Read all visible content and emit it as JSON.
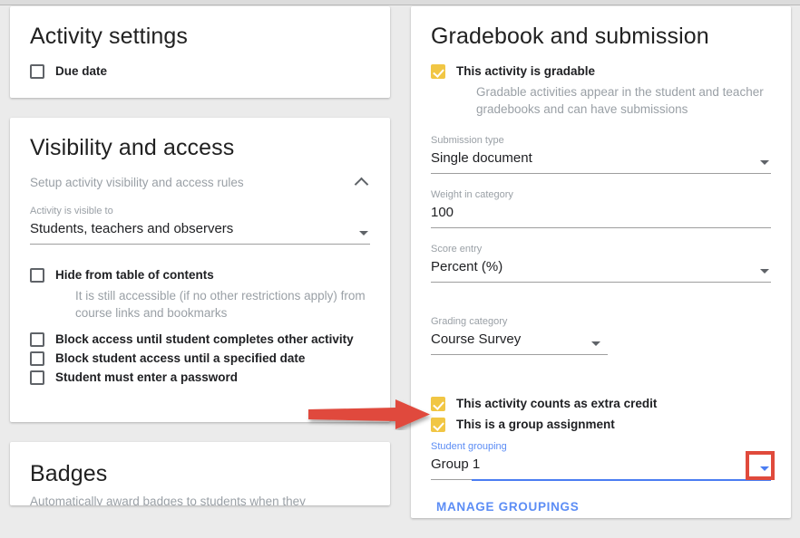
{
  "theme": {
    "accent_yellow": "#f1c644",
    "accent_blue": "#5c8df5",
    "annotation_red": "#e04a3c",
    "page_bg": "#ebebeb",
    "card_bg": "#ffffff",
    "text_primary": "#202124",
    "text_muted": "#9aa0a6"
  },
  "left_column": {
    "activity_settings": {
      "title": "Activity settings",
      "due_date": {
        "label": "Due date",
        "checked": false
      }
    },
    "visibility_and_access": {
      "title": "Visibility and access",
      "collapse_header": "Setup activity visibility and access rules",
      "collapse_icon": "chevron-up-icon",
      "visible_to": {
        "label": "Activity is visible to",
        "value": "Students, teachers and observers"
      },
      "checkboxes": [
        {
          "label": "Hide from table of contents",
          "checked": false,
          "help": "It is still accessible (if no other restrictions apply) from course links and bookmarks"
        },
        {
          "label": "Block access until student completes other activity",
          "checked": false,
          "help": ""
        },
        {
          "label": "Block student access until a specified date",
          "checked": false,
          "help": ""
        },
        {
          "label": "Student must enter a password",
          "checked": false,
          "help": ""
        }
      ]
    },
    "badges": {
      "title": "Badges",
      "subtitle": "Automatically award badges to students when they successfully"
    }
  },
  "right_column": {
    "gradebook_and_submission": {
      "title": "Gradebook and submission",
      "gradable": {
        "label": "This activity is gradable",
        "checked": true,
        "help": "Gradable activities appear in the student and teacher gradebooks and can have submissions"
      },
      "submission_type": {
        "label": "Submission type",
        "value": "Single document"
      },
      "weight_in_category": {
        "label": "Weight in category",
        "value": "100"
      },
      "score_entry": {
        "label": "Score entry",
        "value": "Percent (%)"
      },
      "grading_category": {
        "label": "Grading category",
        "value": "Course Survey"
      },
      "extra_credit": {
        "label": "This activity counts as extra credit",
        "checked": true
      },
      "group_assignment": {
        "label": "This is a group assignment",
        "checked": true
      },
      "student_grouping": {
        "label": "Student grouping",
        "value": "Group 1",
        "focused": true,
        "highlighted": true
      },
      "manage_groupings_label": "MANAGE GROUPINGS"
    }
  },
  "annotations": {
    "arrow": {
      "color": "#e04a3c",
      "direction": "right",
      "points_to": "student-grouping-field"
    },
    "highlight_box": {
      "color": "#e04a3c",
      "target": "student-grouping-dropdown-arrow"
    }
  }
}
